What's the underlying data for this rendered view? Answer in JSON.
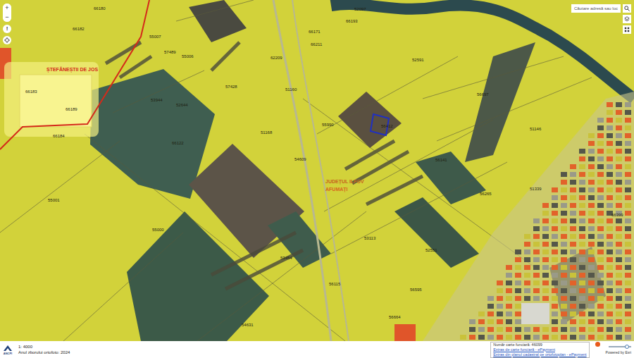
{
  "map": {
    "localities": [
      {
        "name": "ȘTEFĂNEȘTII DE JOS",
        "color": "#d42a1a"
      },
      {
        "name": "JUDEȚUL ILFOV",
        "color": "#c8641e"
      },
      {
        "name": "AFUMAȚI",
        "color": "#d8641e"
      }
    ],
    "parcels": [
      {
        "number": "66180"
      },
      {
        "number": "66182"
      },
      {
        "number": "55007"
      },
      {
        "number": "57489"
      },
      {
        "number": "55006"
      },
      {
        "number": "66183"
      },
      {
        "number": "66189"
      },
      {
        "number": "66184"
      },
      {
        "number": "53944"
      },
      {
        "number": "52644"
      },
      {
        "number": "57428"
      },
      {
        "number": "51168"
      },
      {
        "number": "66171"
      },
      {
        "number": "62209"
      },
      {
        "number": "51160"
      },
      {
        "number": "52591"
      },
      {
        "number": "56697"
      },
      {
        "number": "54609"
      },
      {
        "number": "51146"
      },
      {
        "number": "51339"
      },
      {
        "number": "56141"
      },
      {
        "number": "56412"
      },
      {
        "number": "55001"
      },
      {
        "number": "55000"
      },
      {
        "number": "66122"
      },
      {
        "number": "56265"
      },
      {
        "number": "53113"
      },
      {
        "number": "52551"
      },
      {
        "number": "56595"
      },
      {
        "number": "56115"
      },
      {
        "number": "56664"
      },
      {
        "number": "54631"
      },
      {
        "number": "53454"
      },
      {
        "number": "66399"
      },
      {
        "number": "55990"
      },
      {
        "number": "66193"
      },
      {
        "number": "52097"
      },
      {
        "number": "66211"
      }
    ]
  },
  "zoom": {
    "in": "+",
    "out": "−"
  },
  "info_button": "!",
  "search": {
    "placeholder": "Căutare adresă sau loc"
  },
  "status_bar": {
    "logo": "ANCPI",
    "scale": "1: 4000",
    "ortho_year": "Anul zborului ortofoto: 2024"
  },
  "popup": {
    "title": "Număr carte funciară: 46099",
    "links": [
      "Extras de carte funciară - ePayment",
      "Extras din planul cadastral pe ortofotoplan - ePayment"
    ]
  },
  "opacity_slider": {
    "level": 0.8
  },
  "attribution": "Powered by Esri"
}
